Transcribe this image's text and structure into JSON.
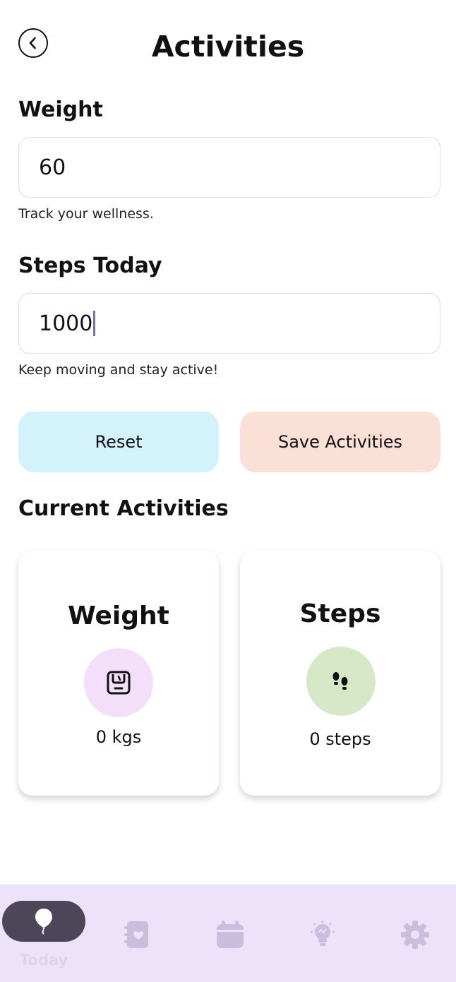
{
  "header": {
    "title": "Activities",
    "back_icon": "back-arrow-icon"
  },
  "weight_field": {
    "label": "Weight",
    "value": "60",
    "helper": "Track your wellness."
  },
  "steps_field": {
    "label": "Steps Today",
    "value": "1000",
    "helper": "Keep moving and stay active!"
  },
  "actions": {
    "reset_label": "Reset",
    "save_label": "Save Activities"
  },
  "current": {
    "title": "Current Activities",
    "weight_card": {
      "title": "Weight",
      "value": "0 kgs",
      "icon": "scale-icon",
      "color": "#f4dffb"
    },
    "steps_card": {
      "title": "Steps",
      "value": "0 steps",
      "icon": "footsteps-icon",
      "color": "#d6e8c8"
    }
  },
  "nav": {
    "items": [
      {
        "label": "Today",
        "icon": "balloon-icon",
        "active": true
      },
      {
        "icon": "journal-icon",
        "active": false
      },
      {
        "icon": "calendar-icon",
        "active": false
      },
      {
        "icon": "lightbulb-icon",
        "active": false
      },
      {
        "icon": "gear-icon",
        "active": false
      }
    ]
  },
  "colors": {
    "reset_bg": "#d4f2fb",
    "save_bg": "#fbe0d8",
    "nav_bg": "#ece3fb",
    "nav_active": "#4d4558",
    "nav_inactive_icon": "#c9bedb"
  }
}
